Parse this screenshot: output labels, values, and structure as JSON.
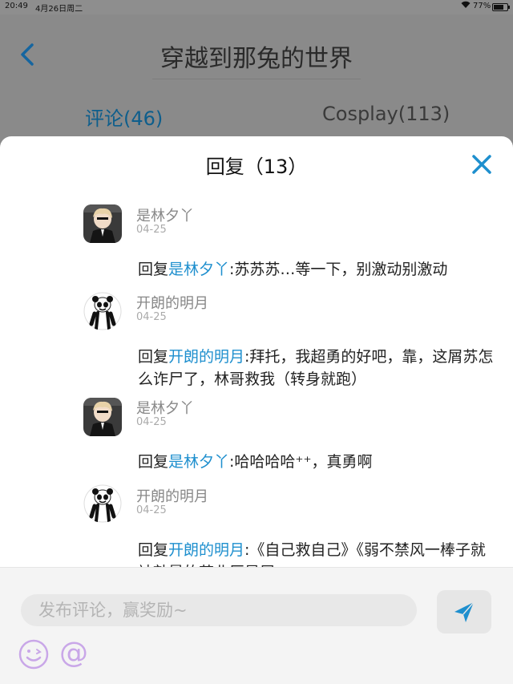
{
  "status_bar": {
    "time": "20:49",
    "date": "4月26日周二",
    "battery_text": "77%",
    "battery_level": 0.77
  },
  "header": {
    "title": "穿越到那兔的世界"
  },
  "tabs": [
    {
      "label": "评论(46)",
      "active": true
    },
    {
      "label": "Cosplay(113)",
      "active": false
    }
  ],
  "sheet": {
    "title": "回复（13）"
  },
  "replies": [
    {
      "username": "是林夕丫",
      "date": "04-25",
      "avatar": "anime-boy-avatar",
      "prefix": "回复",
      "target": "是林夕丫",
      "text": ":苏苏苏…等一下，别激动别激动"
    },
    {
      "username": "开朗的明月",
      "date": "04-25",
      "avatar": "panda-meme-avatar",
      "prefix": "回复",
      "target": "开朗的明月",
      "text": ":拜托，我超勇的好吧，靠，这屑苏怎么诈尸了，林哥救我（转身就跑）"
    },
    {
      "username": "是林夕丫",
      "date": "04-25",
      "avatar": "anime-boy-avatar",
      "prefix": "回复",
      "target": "是林夕丫",
      "text": ":哈哈哈哈⁺⁺，真勇啊"
    },
    {
      "username": "开朗的明月",
      "date": "04-25",
      "avatar": "panda-meme-avatar",
      "prefix": "回复",
      "target": "开朗的明月",
      "text": ":《自己救自己》《弱不禁风一棒子就被敲晕的苏北辰是屑"
    }
  ],
  "input": {
    "placeholder": "发布评论，赢奖励~",
    "mention": "@"
  },
  "colors": {
    "accent": "#1e8fce",
    "tab_active": "#0e5e8c",
    "mention": "#c9a7e8"
  }
}
